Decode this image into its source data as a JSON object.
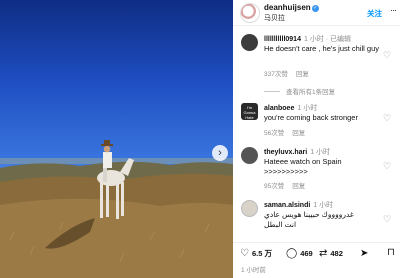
{
  "post": {
    "username": "deanhuijsen",
    "verified_mark": "✓",
    "subtitle": "马贝拉",
    "follow_label": "关注",
    "more_label": "···",
    "next_label": "›"
  },
  "comments": [
    {
      "user": "lllllllllll0914",
      "time": "1 小时 · 已编辑",
      "text": "He doesn't care , he's just chill guy",
      "likes": "337次赞",
      "reply": "回复",
      "avatar_color": "#3c3c3c"
    },
    {
      "user": "alanboee",
      "time": "1 小时",
      "text": "you're coming back stronger",
      "likes": "56次赞",
      "reply": "回复",
      "avatar_color": "#2a2a2a",
      "avatar_text": "I'm Gonna Hate"
    },
    {
      "user": "theyluvx.hari",
      "time": "1 小时",
      "text": "Hateee watch on Spain >>>>>>>>>>",
      "likes": "95次赞",
      "reply": "回复",
      "avatar_color": "#555555"
    },
    {
      "user": "saman.alsindi",
      "time": "1 小时",
      "text": "غدرووووك حبيبنا هويس عادي انت البطل",
      "likes": "",
      "reply": "",
      "avatar_color": "#d8d2c8"
    }
  ],
  "view_replies": "查看所有1条回复",
  "actions": {
    "likes": "6.5 万",
    "comments": "469",
    "shares": "482",
    "heart_icon": "♡",
    "comment_icon": "◯",
    "share_icon": "⇄",
    "send_icon": "➤",
    "bookmark_icon": "⊓"
  },
  "date": "1 小时前",
  "colors": {
    "accent": "#0095f6",
    "verified": "#3897f0",
    "muted": "#8e8e8e"
  }
}
